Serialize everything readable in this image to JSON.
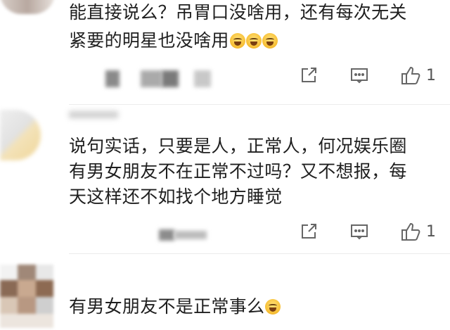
{
  "comments": [
    {
      "text_line1": "能直接说么？吊胃口没啥用，还有每次无关",
      "text_line2": "紧要的明星也没啥用",
      "likes": "1",
      "icons": [
        "share-icon",
        "comment-icon",
        "thumbs-up-icon"
      ]
    },
    {
      "text_line1": "说句实话，只要是人，正常人，何况娱乐圈",
      "text_line2": "有男女朋友不在正常不过吗？又不想报，每",
      "text_line3": "天这样还不如找个地方睡觉",
      "likes": "1",
      "icons": [
        "share-icon",
        "comment-icon",
        "thumbs-up-icon"
      ]
    },
    {
      "text_line1": "有男女朋友不是正常事么"
    }
  ],
  "emoji_name": "laughing-crying-emoji"
}
